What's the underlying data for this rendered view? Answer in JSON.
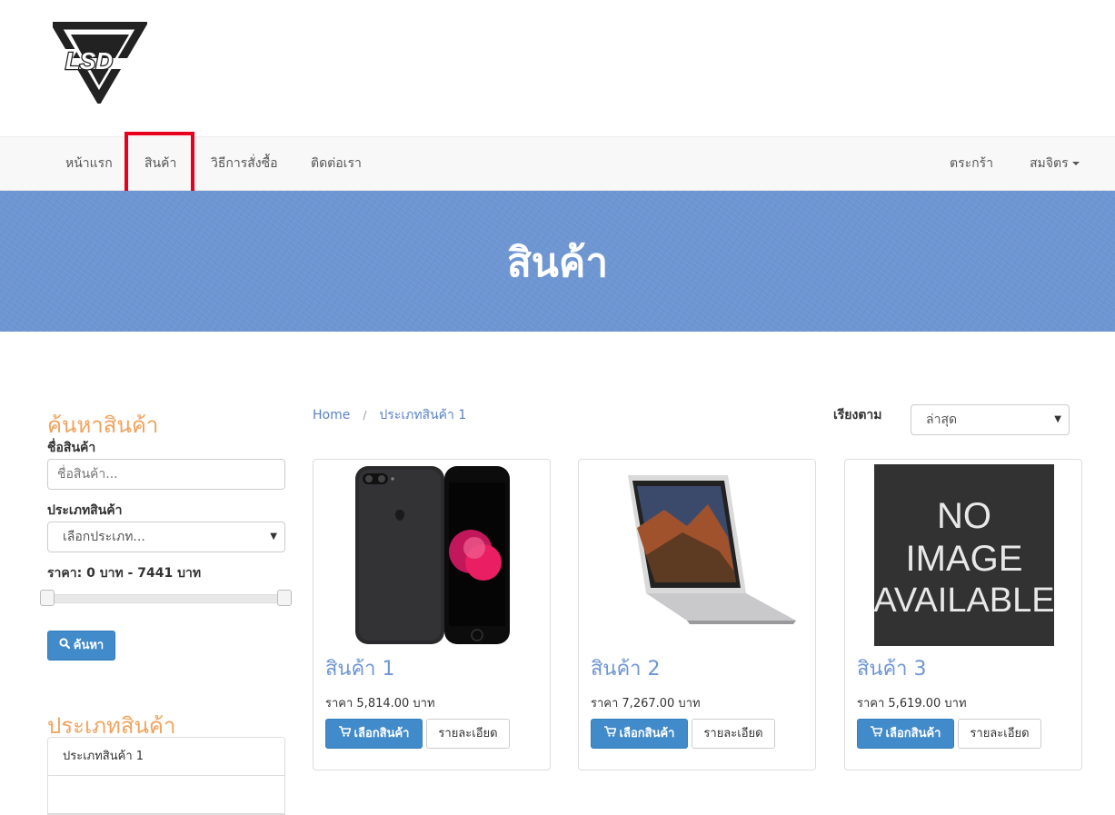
{
  "brand": {
    "logo_text": "LSD"
  },
  "nav": {
    "items": [
      {
        "label": "หน้าแรก"
      },
      {
        "label": "สินค้า"
      },
      {
        "label": "วิธีการสั่งซื้อ"
      },
      {
        "label": "ติดต่อเรา"
      }
    ],
    "cart_label": "ตระกร้า",
    "member_label": "สมจิตร"
  },
  "banner": {
    "title": "สินค้า"
  },
  "search": {
    "title": "ค้นหาสินค้า",
    "name_label": "ชื่อสินค้า",
    "name_placeholder": "ชื่อสินค้า...",
    "type_label": "ประเภทสินค้า",
    "type_selected": "เลือกประเภท...",
    "price_label": "ราคา: 0 บาท - 7441 บาท",
    "price_min": 0,
    "price_max": 7441,
    "search_button": "ค้นหา"
  },
  "categories": {
    "title": "ประเภทสินค้า",
    "items": [
      "ประเภทสินค้า 1"
    ]
  },
  "breadcrumb": {
    "home": "Home",
    "separator": "/",
    "current": "ประเภทสินค้า 1"
  },
  "sort": {
    "label": "เรียงตาม",
    "selected": "ล่าสุด"
  },
  "products": [
    {
      "name": "สินค้า 1",
      "price": "ราคา 5,814.00 บาท",
      "image": "iphone-image",
      "add_label": "เลือกสินค้า",
      "detail_label": "รายละเอียด"
    },
    {
      "name": "สินค้า 2",
      "price": "ราคา 7,267.00 บาท",
      "image": "macbook-image",
      "add_label": "เลือกสินค้า",
      "detail_label": "รายละเอียด"
    },
    {
      "name": "สินค้า 3",
      "price": "ราคา 5,619.00 บาท",
      "image": "no-image-placeholder",
      "add_label": "เลือกสินค้า",
      "detail_label": "รายละเอียด",
      "image_text": [
        "NO",
        "IMAGE",
        "AVAILABLE"
      ]
    }
  ],
  "colors": {
    "accent": "#428bca",
    "banner": "#6e96d2",
    "heading": "#f0a35e",
    "highlight": "#e8001c"
  }
}
